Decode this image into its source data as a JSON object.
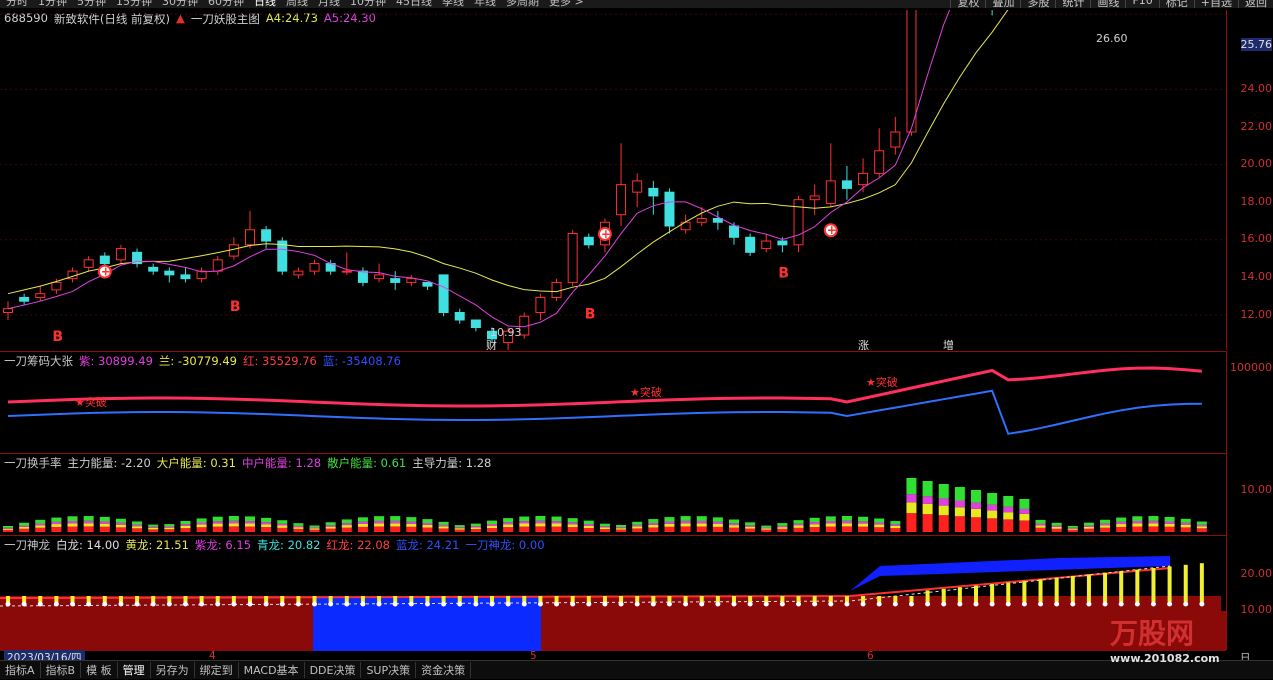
{
  "top_menu": [
    "分时",
    "1分钟",
    "5分钟",
    "15分钟",
    "30分钟",
    "60分钟",
    "日线",
    "周线",
    "月线",
    "10分钟",
    "45日线",
    "季线",
    "年线",
    "多周期",
    "更多 >"
  ],
  "top_tools": [
    "复权",
    "叠加",
    "多股",
    "统计",
    "画线",
    "F10",
    "标记",
    "+自选",
    "返回"
  ],
  "main": {
    "code": "688590",
    "name": "新致软件(日线 前复权)",
    "indicator": "一刀妖股主图",
    "a4_label": "A4:",
    "a4": "24.73",
    "a5_label": "A5:",
    "a5": "24.30",
    "high_label": "26.60",
    "low_label": "10.93",
    "markers": [
      "财",
      "涨",
      "增"
    ]
  },
  "main_axis": [
    "25.76",
    "24.00",
    "22.00",
    "20.00",
    "18.00",
    "16.00",
    "14.00",
    "12.00"
  ],
  "p2": {
    "title": "一刀筹码大张",
    "f1": "紫: 30899.49",
    "f2": "兰: -30779.49",
    "f3": "红: 35529.76",
    "f4": "蓝: -35408.76",
    "breakout": "突破",
    "axis": "100000"
  },
  "p3": {
    "title": "一刀换手率",
    "f1": "主力能量: -2.20",
    "f2": "大户能量: 0.31",
    "f3": "中户能量: 1.28",
    "f4": "散户能量: 0.61",
    "f5": "主导力量: 1.28",
    "axis": "10.00"
  },
  "p4": {
    "title": "一刀神龙",
    "f1": "白龙: 14.00",
    "f2": "黄龙: 21.51",
    "f3": "紫龙: 6.15",
    "f4": "青龙: 20.82",
    "f5": "红龙: 22.08",
    "f6": "蓝龙: 24.21",
    "f7": "一刀神龙: 0.00",
    "axis1": "20.00",
    "axis2": "10.00"
  },
  "date": {
    "current": "2023/03/16/四",
    "m4": "4",
    "m5": "5",
    "m6": "6",
    "period": "日线"
  },
  "bottom_tabs": [
    "指标A",
    "指标B",
    "模 板",
    "管理",
    "另存为",
    "绑定到",
    "MACD基本",
    "DDE决策",
    "SUP决策",
    "资金决策"
  ],
  "watermark": "万股网",
  "watermark_url": "www.201082.com"
}
